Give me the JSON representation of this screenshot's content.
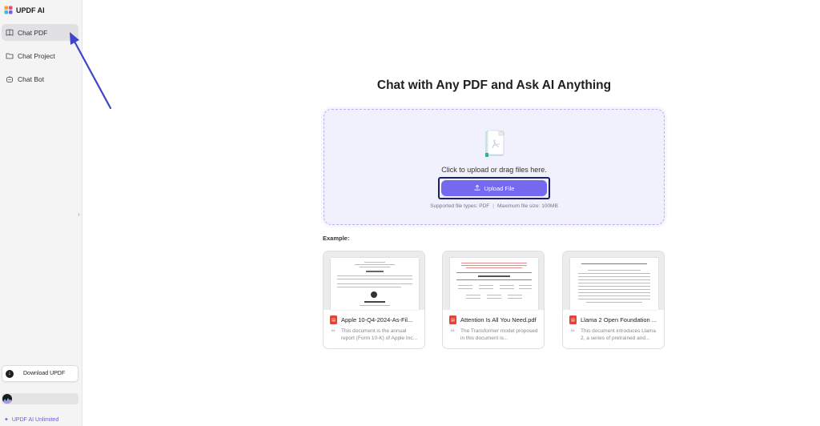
{
  "app": {
    "name": "UPDF AI"
  },
  "sidebar": {
    "items": [
      {
        "label": "Chat PDF",
        "icon": "book-icon",
        "active": true
      },
      {
        "label": "Chat Project",
        "icon": "folder-icon",
        "active": false
      },
      {
        "label": "Chat Bot",
        "icon": "bot-icon",
        "active": false
      }
    ],
    "download_label": "Download UPDF",
    "unlimited_label": "UPDF AI Unlimited"
  },
  "main": {
    "heading": "Chat with Any PDF and Ask AI Anything",
    "upload": {
      "prompt": "Click to upload or drag files here.",
      "button_label": "Upload File",
      "file_types": "Supported file types: PDF",
      "max_size": "Maximum file size: 100MB"
    },
    "example_label": "Example:",
    "examples": [
      {
        "title": "Apple 10-Q4-2024-As-Fil...",
        "desc": "This document is the annual report (Form 10-K) of Apple Inc..."
      },
      {
        "title": "Attention Is All You Need.pdf",
        "desc": "The Transformer model proposed in this document is..."
      },
      {
        "title": "Llama 2 Open Foundation ...",
        "desc": "This document introduces Llama 2, a series of pretrained and..."
      }
    ]
  },
  "colors": {
    "accent": "#7469ef",
    "annotation_arrow": "#3f45c9",
    "pdf_red": "#e0443a"
  }
}
